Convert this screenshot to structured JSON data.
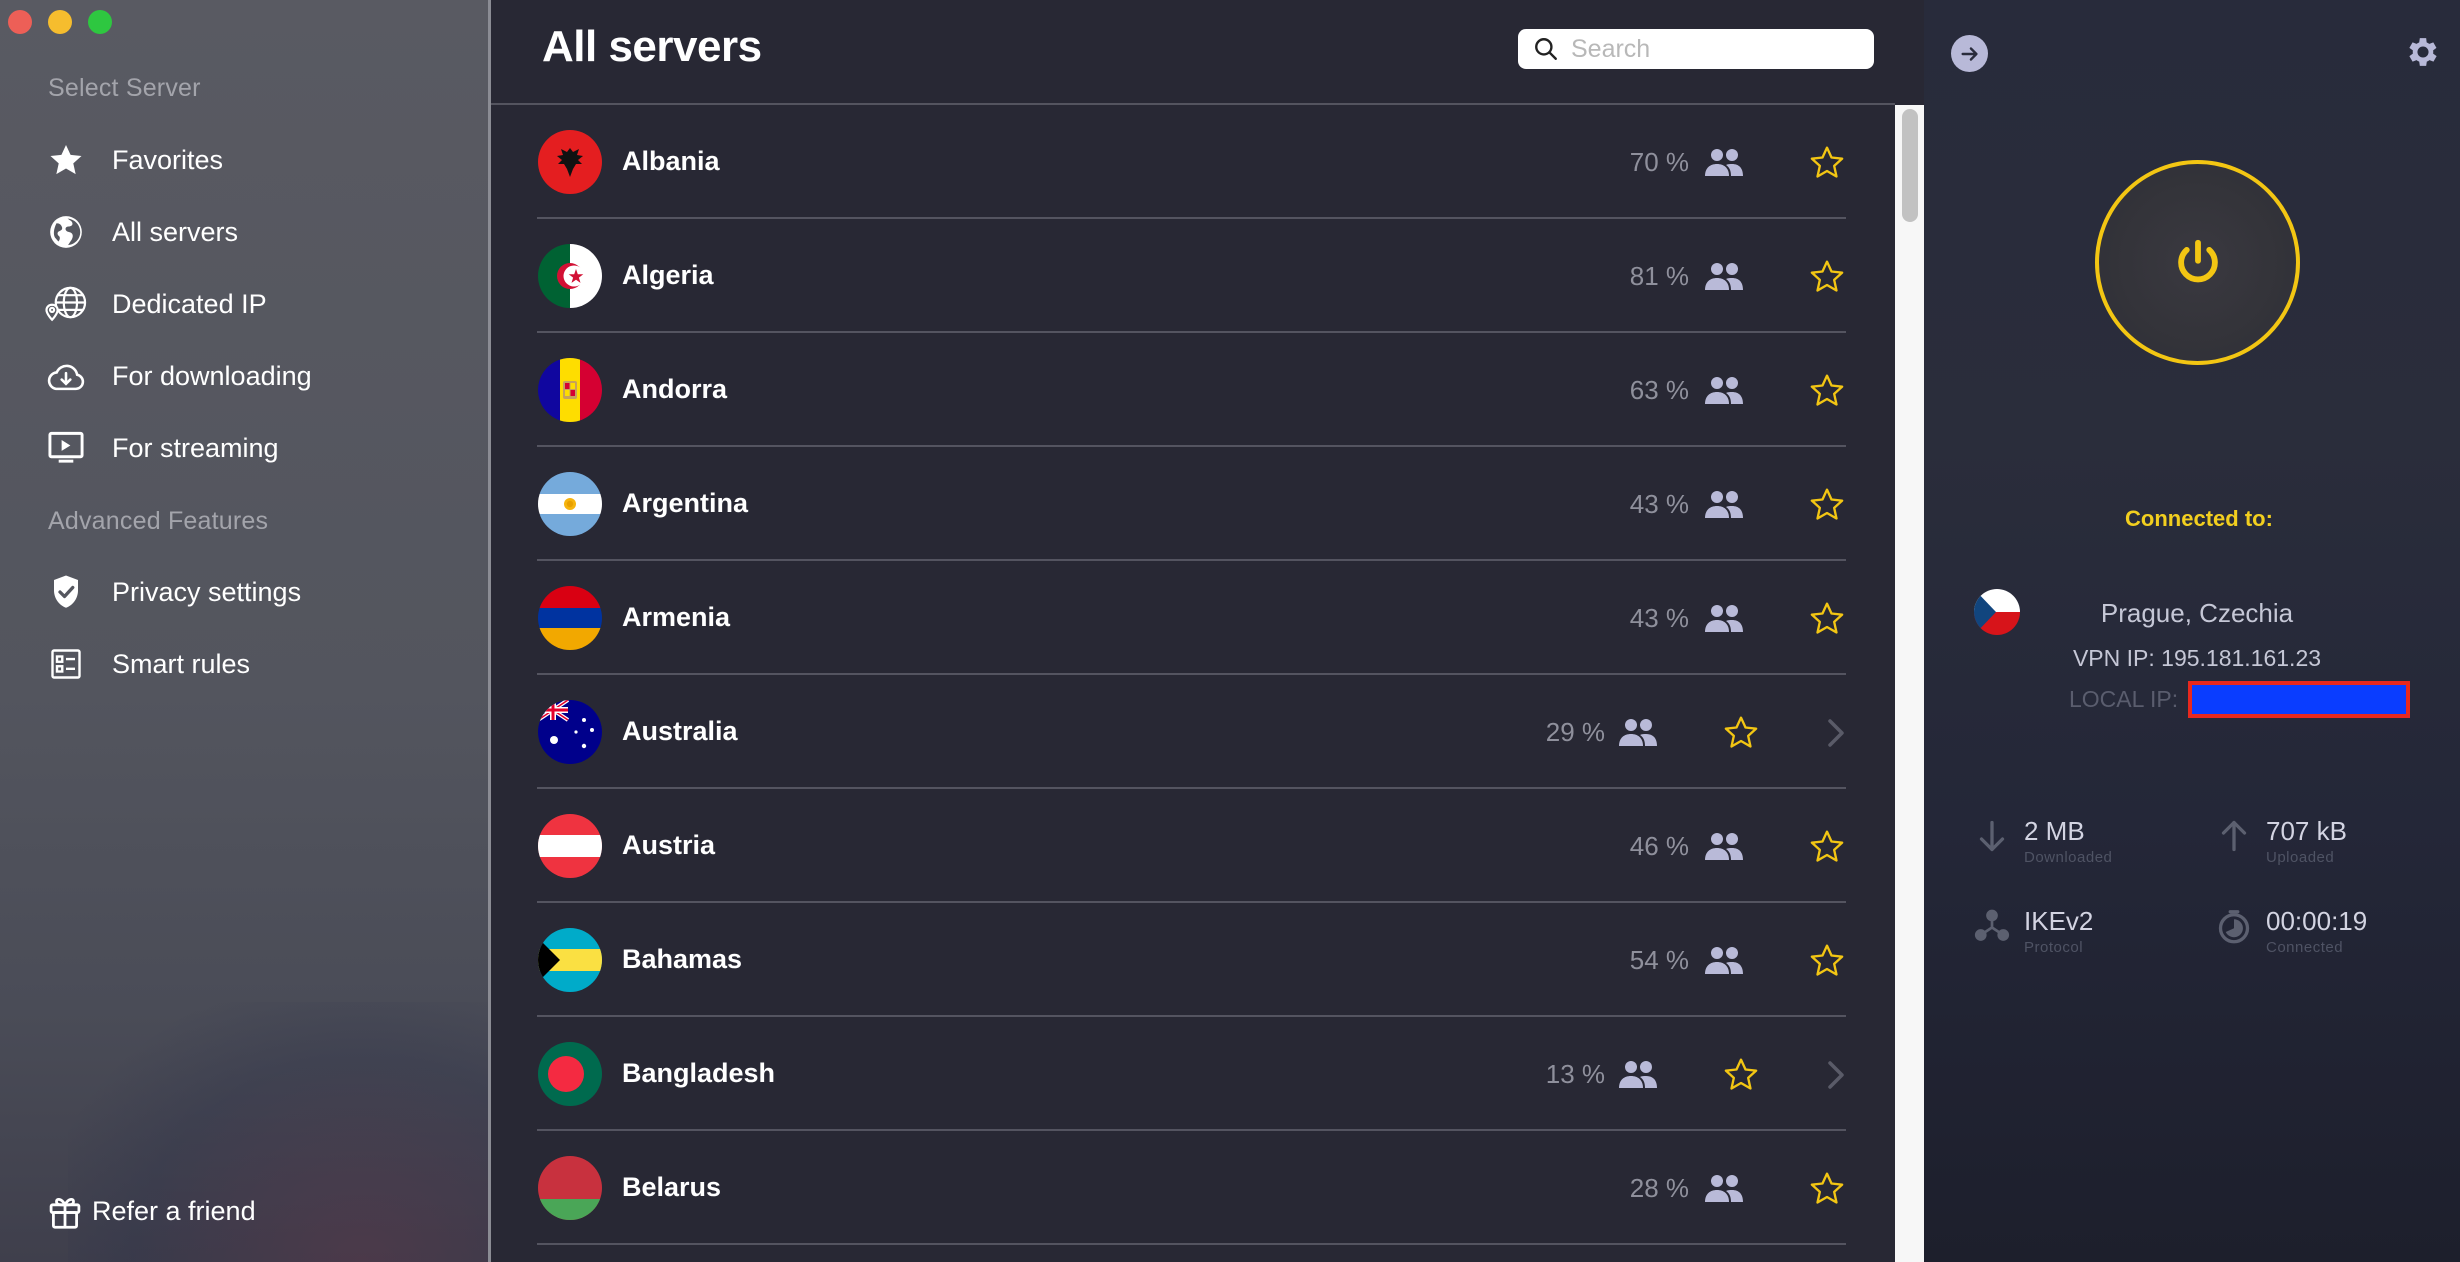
{
  "window": {
    "controls": [
      "close",
      "minimize",
      "maximize"
    ]
  },
  "sidebar": {
    "select_server_heading": "Select Server",
    "server_items": [
      {
        "label": "Favorites",
        "icon": "star-icon"
      },
      {
        "label": "All servers",
        "icon": "globe-icon"
      },
      {
        "label": "Dedicated IP",
        "icon": "dedicated-ip-globe-icon"
      },
      {
        "label": "For downloading",
        "icon": "cloud-download-icon"
      },
      {
        "label": "For streaming",
        "icon": "tv-play-icon"
      }
    ],
    "advanced_heading": "Advanced Features",
    "advanced_items": [
      {
        "label": "Privacy settings",
        "icon": "shield-check-icon"
      },
      {
        "label": "Smart rules",
        "icon": "rules-list-icon"
      }
    ],
    "refer": {
      "label": "Refer a friend",
      "icon": "gift-icon"
    }
  },
  "main": {
    "title": "All servers",
    "search": {
      "placeholder": "Search",
      "value": ""
    },
    "servers": [
      {
        "country": "Albania",
        "load": "70 %",
        "favorite": false,
        "has_submenu": false,
        "flag": "albania"
      },
      {
        "country": "Algeria",
        "load": "81 %",
        "favorite": false,
        "has_submenu": false,
        "flag": "algeria"
      },
      {
        "country": "Andorra",
        "load": "63 %",
        "favorite": false,
        "has_submenu": false,
        "flag": "andorra"
      },
      {
        "country": "Argentina",
        "load": "43 %",
        "favorite": false,
        "has_submenu": false,
        "flag": "argentina"
      },
      {
        "country": "Armenia",
        "load": "43 %",
        "favorite": false,
        "has_submenu": false,
        "flag": "armenia"
      },
      {
        "country": "Australia",
        "load": "29 %",
        "favorite": false,
        "has_submenu": true,
        "flag": "australia"
      },
      {
        "country": "Austria",
        "load": "46 %",
        "favorite": false,
        "has_submenu": false,
        "flag": "austria"
      },
      {
        "country": "Bahamas",
        "load": "54 %",
        "favorite": false,
        "has_submenu": false,
        "flag": "bahamas"
      },
      {
        "country": "Bangladesh",
        "load": "13 %",
        "favorite": false,
        "has_submenu": true,
        "flag": "bangladesh"
      },
      {
        "country": "Belarus",
        "load": "28 %",
        "favorite": false,
        "has_submenu": false,
        "flag": "belarus"
      }
    ]
  },
  "panel": {
    "status_label": "Connected to:",
    "location": "Prague, Czechia",
    "location_flag": "czechia",
    "vpn_ip": "VPN IP: 195.181.161.23",
    "local_ip_label": "LOCAL IP:",
    "local_ip_redacted": true,
    "stats": {
      "downloaded": {
        "value": "2 MB",
        "caption": "Downloaded"
      },
      "uploaded": {
        "value": "707 kB",
        "caption": "Uploaded"
      },
      "protocol": {
        "value": "IKEv2",
        "caption": "Protocol"
      },
      "connected": {
        "value": "00:00:19",
        "caption": "Connected"
      }
    },
    "colors": {
      "accent": "#f3c613",
      "status_text": "#f2cf1f",
      "redaction_fill": "#0a3dff",
      "redaction_border": "#e8281e"
    }
  }
}
